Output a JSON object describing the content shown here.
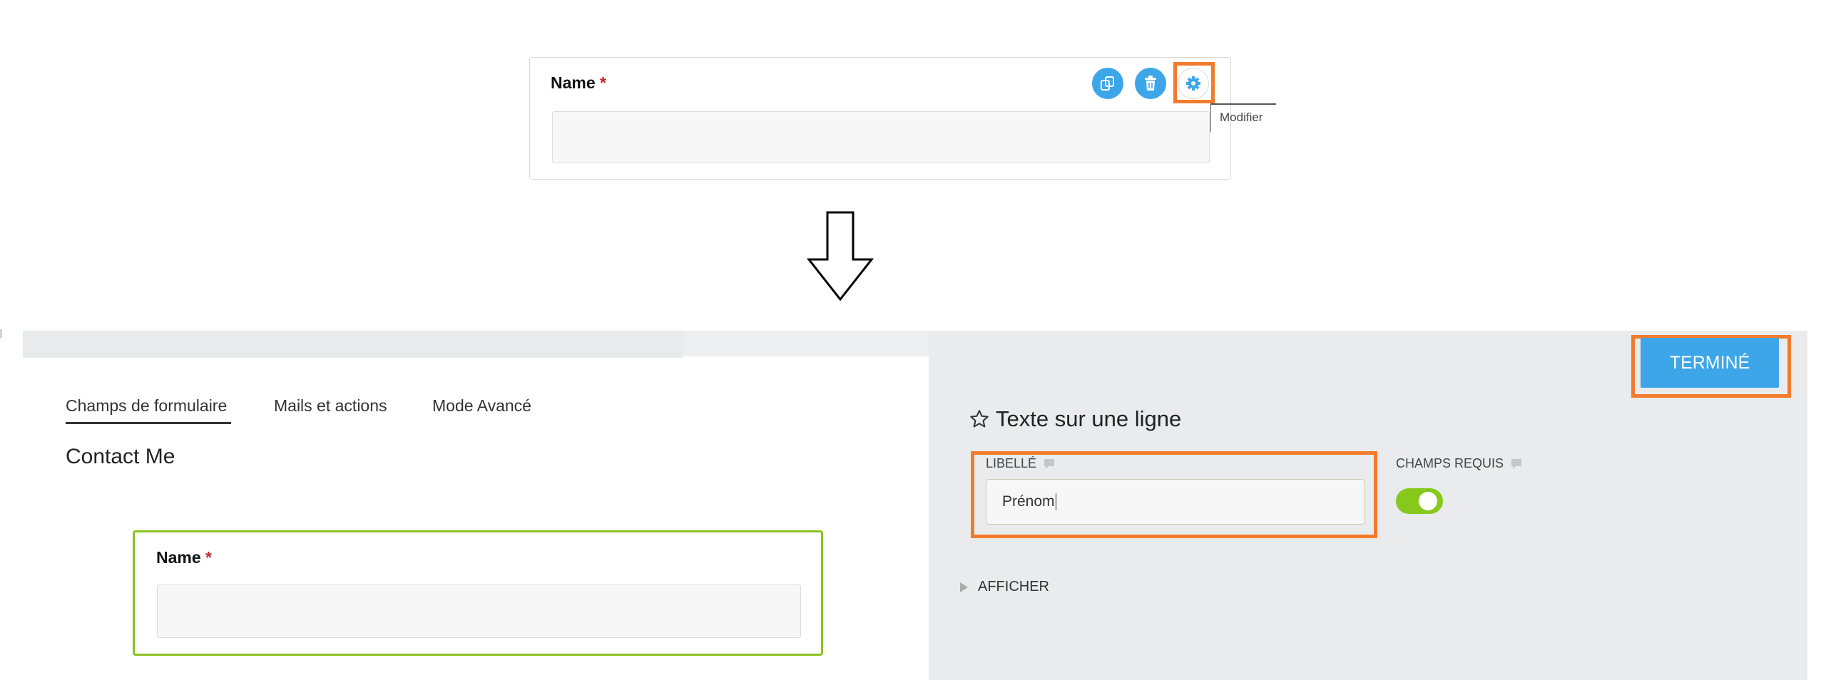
{
  "preview": {
    "field_label": "Name",
    "required_mark": "*",
    "actions": [
      {
        "name": "copy-icon"
      },
      {
        "name": "trash-icon"
      },
      {
        "name": "gear-icon"
      }
    ],
    "tooltip": "Modifier"
  },
  "editor": {
    "tabs": [
      {
        "label": "Champs de formulaire",
        "active": true
      },
      {
        "label": "Mails et actions",
        "active": false
      },
      {
        "label": "Mode Avancé",
        "active": false
      }
    ],
    "form_title": "Contact Me",
    "field": {
      "label": "Name",
      "required_mark": "*"
    },
    "done_button": "TERMINÉ",
    "field_type": {
      "icon": "star-outline-icon",
      "title": "Texte sur une ligne"
    },
    "label_caption": "LIBELLÉ",
    "label_value": "Prénom",
    "required_caption": "CHAMPS REQUIS",
    "required_on": true,
    "show_more": "AFFICHER"
  },
  "colors": {
    "accent_blue": "#3da6e8",
    "highlight_orange": "#f27b2c",
    "selected_green": "#8bc31f",
    "toggle_green": "#86c91c",
    "required_red": "#c0272d"
  }
}
